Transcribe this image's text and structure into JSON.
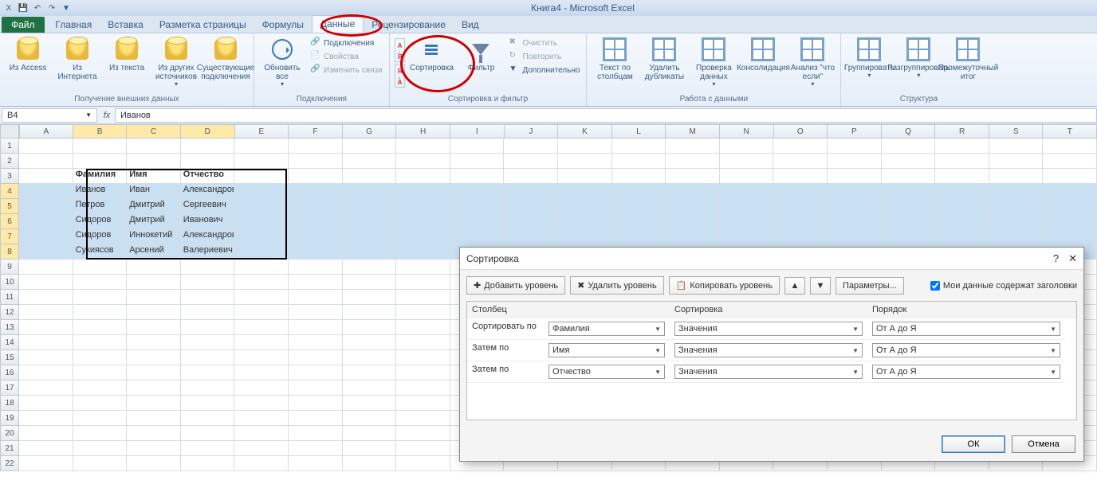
{
  "app": {
    "title": "Книга4  -  Microsoft Excel"
  },
  "qat": {
    "save": "💾",
    "undo": "↶",
    "redo": "↷"
  },
  "tabs": {
    "file": "Файл",
    "items": [
      "Главная",
      "Вставка",
      "Разметка страницы",
      "Формулы",
      "Данные",
      "Рецензирование",
      "Вид"
    ],
    "active": 4
  },
  "ribbon": {
    "g1": {
      "label": "Получение внешних данных",
      "btns": [
        "Из Access",
        "Из Интернета",
        "Из текста",
        "Из других источников",
        "Существующие подключения"
      ]
    },
    "g2": {
      "label": "Подключения",
      "refresh": "Обновить все",
      "items": [
        "Подключения",
        "Свойства",
        "Изменить связи"
      ]
    },
    "g3": {
      "label": "Сортировка и фильтр",
      "sortaz": "А↓Я",
      "sortza": "Я↓А",
      "sort": "Сортировка",
      "filter": "Фильтр",
      "clear": "Очистить",
      "reapply": "Повторить",
      "advanced": "Дополнительно"
    },
    "g4": {
      "label": "Работа с данными",
      "btns": [
        "Текст по столбцам",
        "Удалить дубликаты",
        "Проверка данных",
        "Консолидация",
        "Анализ \"что если\""
      ]
    },
    "g5": {
      "label": "Структура",
      "btns": [
        "Группировать",
        "Разгруппировать",
        "Промежуточный итог"
      ]
    }
  },
  "formula": {
    "cell": "B4",
    "fx": "fx",
    "value": "Иванов"
  },
  "columns": [
    "A",
    "B",
    "C",
    "D",
    "E",
    "F",
    "G",
    "H",
    "I",
    "J",
    "K",
    "L",
    "M",
    "N",
    "O",
    "P",
    "Q",
    "R",
    "S",
    "T"
  ],
  "rowcount": 22,
  "table": {
    "headers": [
      "Фамилия",
      "Имя",
      "Отчество"
    ],
    "rows": [
      [
        "Иванов",
        "Иван",
        "Александрович"
      ],
      [
        "Петров",
        "Дмитрий",
        "Сергеевич"
      ],
      [
        "Сидоров",
        "Дмитрий",
        "Иванович"
      ],
      [
        "Сидоров",
        "Иннокетий",
        "Александрович"
      ],
      [
        "Сукиясов",
        "Арсений",
        "Валериевич"
      ]
    ]
  },
  "dialog": {
    "title": "Сортировка",
    "add": "Добавить уровень",
    "del": "Удалить уровень",
    "copy": "Копировать уровень",
    "params": "Параметры...",
    "headers_chk": "Мои данные содержат заголовки",
    "col_h": "Столбец",
    "sort_h": "Сортировка",
    "order_h": "Порядок",
    "sortby": "Сортировать по",
    "thenby": "Затем по",
    "levels": [
      {
        "col": "Фамилия",
        "sort": "Значения",
        "order": "От А до Я"
      },
      {
        "col": "Имя",
        "sort": "Значения",
        "order": "От А до Я"
      },
      {
        "col": "Отчество",
        "sort": "Значения",
        "order": "От А до Я"
      }
    ],
    "ok": "ОК",
    "cancel": "Отмена",
    "help": "?",
    "close": "✕"
  }
}
